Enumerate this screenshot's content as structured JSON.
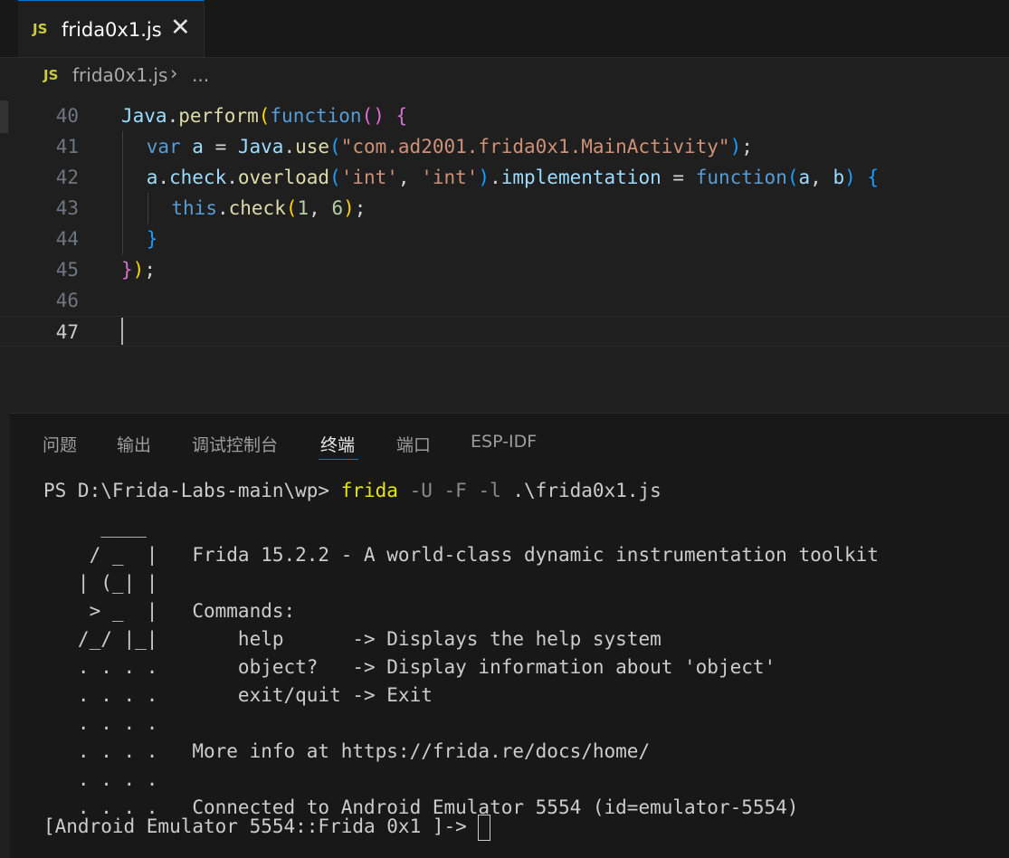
{
  "tab": {
    "badge": "JS",
    "title": "frida0x1.js",
    "close": "✕"
  },
  "breadcrumb": {
    "badge": "JS",
    "file": "frida0x1.js",
    "sep": "›",
    "more": "..."
  },
  "editor": {
    "line_numbers": [
      "40",
      "41",
      "42",
      "43",
      "44",
      "45",
      "46",
      "47"
    ],
    "lines": [
      [
        [
          "v",
          "Java"
        ],
        [
          "",
          "."
        ],
        [
          "f",
          "perform"
        ],
        [
          "p1",
          "("
        ],
        [
          "k",
          "function"
        ],
        [
          "p2",
          "()"
        ],
        [
          "",
          ""
        ],
        [
          "p2",
          " {"
        ]
      ],
      [
        [
          "k",
          "var"
        ],
        [
          "",
          " "
        ],
        [
          "v",
          "a"
        ],
        [
          "",
          " = "
        ],
        [
          "v",
          "Java"
        ],
        [
          "",
          "."
        ],
        [
          "f",
          "use"
        ],
        [
          "p3",
          "("
        ],
        [
          "s",
          "\"com.ad2001.frida0x1.MainActivity\""
        ],
        [
          "p3",
          ")"
        ],
        [
          "",
          ";"
        ]
      ],
      [
        [
          "v",
          "a"
        ],
        [
          "",
          "."
        ],
        [
          "v",
          "check"
        ],
        [
          "",
          "."
        ],
        [
          "f",
          "overload"
        ],
        [
          "p3",
          "("
        ],
        [
          "s",
          "'int'"
        ],
        [
          "",
          ", "
        ],
        [
          "s",
          "'int'"
        ],
        [
          "p3",
          ")"
        ],
        [
          "",
          "."
        ],
        [
          "v",
          "implementation"
        ],
        [
          "",
          " = "
        ],
        [
          "k",
          "function"
        ],
        [
          "p3",
          "("
        ],
        [
          "v",
          "a"
        ],
        [
          "",
          ", "
        ],
        [
          "v",
          "b"
        ],
        [
          "p3",
          ")"
        ],
        [
          "p3",
          " {"
        ]
      ],
      [
        [
          "k",
          "this"
        ],
        [
          "",
          "."
        ],
        [
          "f",
          "check"
        ],
        [
          "p1",
          "("
        ],
        [
          "n",
          "1"
        ],
        [
          "",
          ", "
        ],
        [
          "n",
          "6"
        ],
        [
          "p1",
          ")"
        ],
        [
          "",
          ";"
        ]
      ],
      [
        [
          "p3",
          "}"
        ]
      ],
      [
        [
          "p2",
          "}"
        ],
        [
          "p1",
          ")"
        ],
        [
          "",
          ";"
        ]
      ],
      [],
      []
    ]
  },
  "panel": {
    "tabs": [
      "问题",
      "输出",
      "调试控制台",
      "终端",
      "端口",
      "ESP-IDF"
    ],
    "active_tab": "终端"
  },
  "terminal": {
    "prompt": "PS D:\\Frida-Labs-main\\wp> ",
    "cmd": "frida",
    "args": " -U -F -l",
    "file": " .\\frida0x1.js",
    "banner": [
      "     ____",
      "    / _  |   Frida 15.2.2 - A world-class dynamic instrumentation toolkit",
      "   | (_| |",
      "    > _  |   Commands:",
      "   /_/ |_|       help      -> Displays the help system",
      "   . . . .       object?   -> Display information about 'object'",
      "   . . . .       exit/quit -> Exit",
      "   . . . .",
      "   . . . .   More info at https://frida.re/docs/home/",
      "   . . . .",
      "   . . . .   Connected to Android Emulator 5554 (id=emulator-5554)"
    ],
    "repl_prompt": "[Android Emulator 5554::Frida 0x1 ]-> "
  }
}
